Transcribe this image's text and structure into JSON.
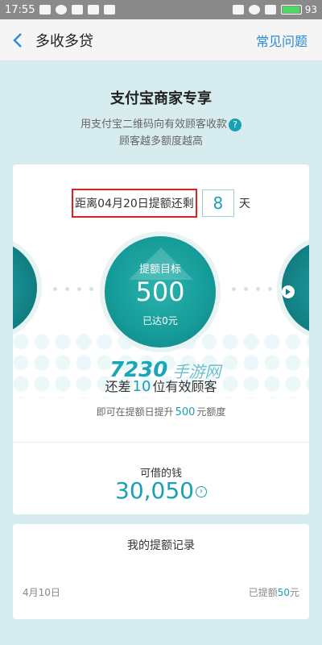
{
  "status_bar": {
    "time": "17:55",
    "battery": "93"
  },
  "nav": {
    "title": "多收多贷",
    "faq_label": "常见问题"
  },
  "header": {
    "title": "支付宝商家专享",
    "subtitle_line1": "用支付宝二维码向有效顾客收款",
    "help_icon_text": "?",
    "subtitle_line2": "顾客越多额度越高"
  },
  "countdown": {
    "label": "距离04月20日提额还剩",
    "days": "8",
    "unit": "天"
  },
  "goal_circle": {
    "label": "提额目标",
    "value": "500",
    "sub": "已达0元"
  },
  "watermark": {
    "num": "7230",
    "text": "手游网"
  },
  "remain": {
    "prefix": "还差",
    "count": "10",
    "suffix": "位有效顾客"
  },
  "raise": {
    "prefix": "即可在提额日提升",
    "amount": "500",
    "suffix": "元额度"
  },
  "borrow": {
    "label": "可借的钱",
    "amount": "30,050"
  },
  "records": {
    "title": "我的提额记录",
    "items": [
      {
        "date": "4月10日",
        "prefix": "已提额",
        "amount": "50",
        "suffix": "元"
      }
    ]
  },
  "colors": {
    "accent": "#19a0b5",
    "circle": "#159b98",
    "highlight": "#e0201f"
  }
}
